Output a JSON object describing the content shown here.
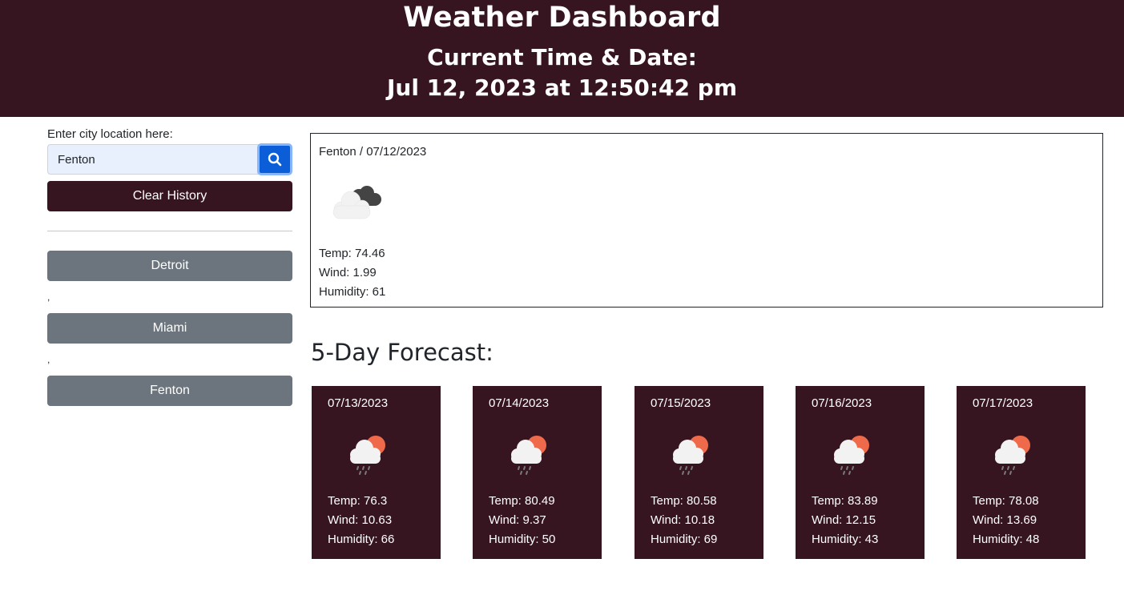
{
  "header": {
    "title": "Weather Dashboard",
    "time_label": "Current Time & Date:",
    "time_value": "Jul 12, 2023 at 12:50:42 pm"
  },
  "search": {
    "label": "Enter city location here:",
    "value": "Fenton",
    "button_icon": "search-icon"
  },
  "clear_button": "Clear History",
  "history": {
    "items": [
      "Detroit",
      "Miami",
      "Fenton"
    ],
    "separator": ","
  },
  "current": {
    "title": "Fenton / 07/12/2023",
    "icon": "cloudy-icon",
    "temp": "Temp: 74.46",
    "wind": "Wind: 1.99",
    "humidity": "Humidity: 61"
  },
  "forecast": {
    "title": "5-Day Forecast:",
    "days": [
      {
        "date": "07/13/2023",
        "icon": "rain-sun-icon",
        "temp": "Temp: 76.3",
        "wind": "Wind: 10.63",
        "humidity": "Humidity: 66"
      },
      {
        "date": "07/14/2023",
        "icon": "rain-sun-icon",
        "temp": "Temp: 80.49",
        "wind": "Wind: 9.37",
        "humidity": "Humidity: 50"
      },
      {
        "date": "07/15/2023",
        "icon": "rain-sun-icon",
        "temp": "Temp: 80.58",
        "wind": "Wind: 10.18",
        "humidity": "Humidity: 69"
      },
      {
        "date": "07/16/2023",
        "icon": "rain-sun-icon",
        "temp": "Temp: 83.89",
        "wind": "Wind: 12.15",
        "humidity": "Humidity: 43"
      },
      {
        "date": "07/17/2023",
        "icon": "rain-sun-icon",
        "temp": "Temp: 78.08",
        "wind": "Wind: 13.69",
        "humidity": "Humidity: 48"
      }
    ]
  },
  "colors": {
    "brand": "#361520",
    "accent": "#0b5ed7",
    "history_button": "#6c757d"
  }
}
